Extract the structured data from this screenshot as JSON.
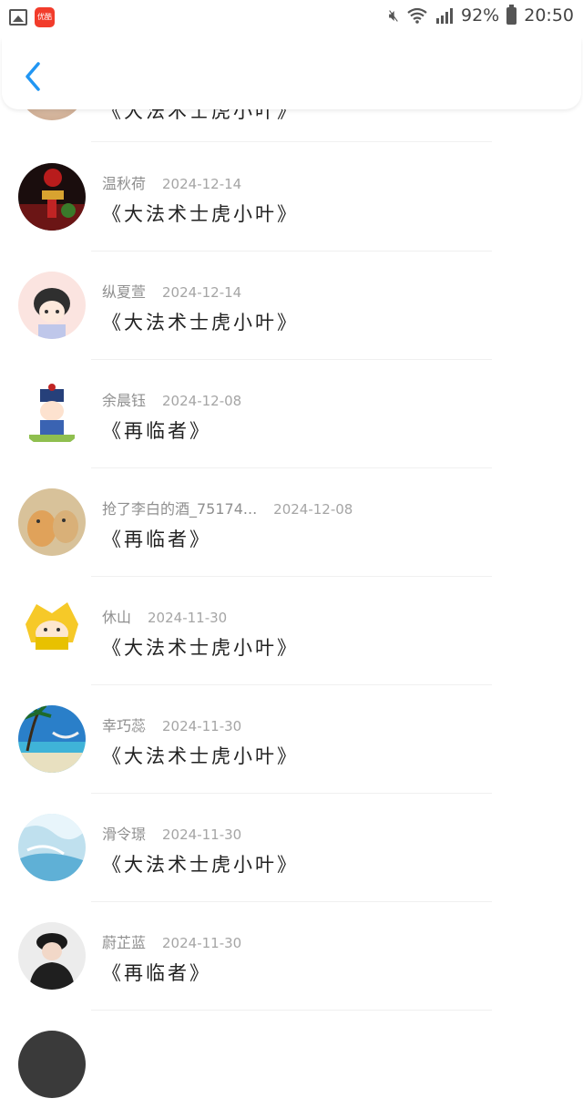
{
  "status_bar": {
    "app_icon_text": "优酷",
    "battery": "92%",
    "time": "20:50"
  },
  "header": {
    "back_icon": "chevron-left-icon",
    "accent_color": "#2196f3"
  },
  "partial_top": {
    "title": "《大法术士虎小叶》"
  },
  "items": [
    {
      "name": "温秋荷",
      "date": "2024-12-14",
      "title": "《大法术士虎小叶》",
      "avatar": "dark-red-lantern"
    },
    {
      "name": "纵夏萱",
      "date": "2024-12-14",
      "title": "《大法术士虎小叶》",
      "avatar": "anime-boy-pink"
    },
    {
      "name": "余晨钰",
      "date": "2024-12-08",
      "title": "《再临者》",
      "avatar": "cartoon-official-hat"
    },
    {
      "name": "抢了李白的酒_75174...",
      "date": "2024-12-08",
      "title": "《再临者》",
      "avatar": "two-cats"
    },
    {
      "name": "休山",
      "date": "2024-11-30",
      "title": "《大法术士虎小叶》",
      "avatar": "yellow-hair-anime"
    },
    {
      "name": "幸巧蕊",
      "date": "2024-11-30",
      "title": "《大法术士虎小叶》",
      "avatar": "beach-palm"
    },
    {
      "name": "滑令璟",
      "date": "2024-11-30",
      "title": "《大法术士虎小叶》",
      "avatar": "ice-cave"
    },
    {
      "name": "蔚芷蓝",
      "date": "2024-11-30",
      "title": "《再临者》",
      "avatar": "girl-black-cap"
    }
  ]
}
